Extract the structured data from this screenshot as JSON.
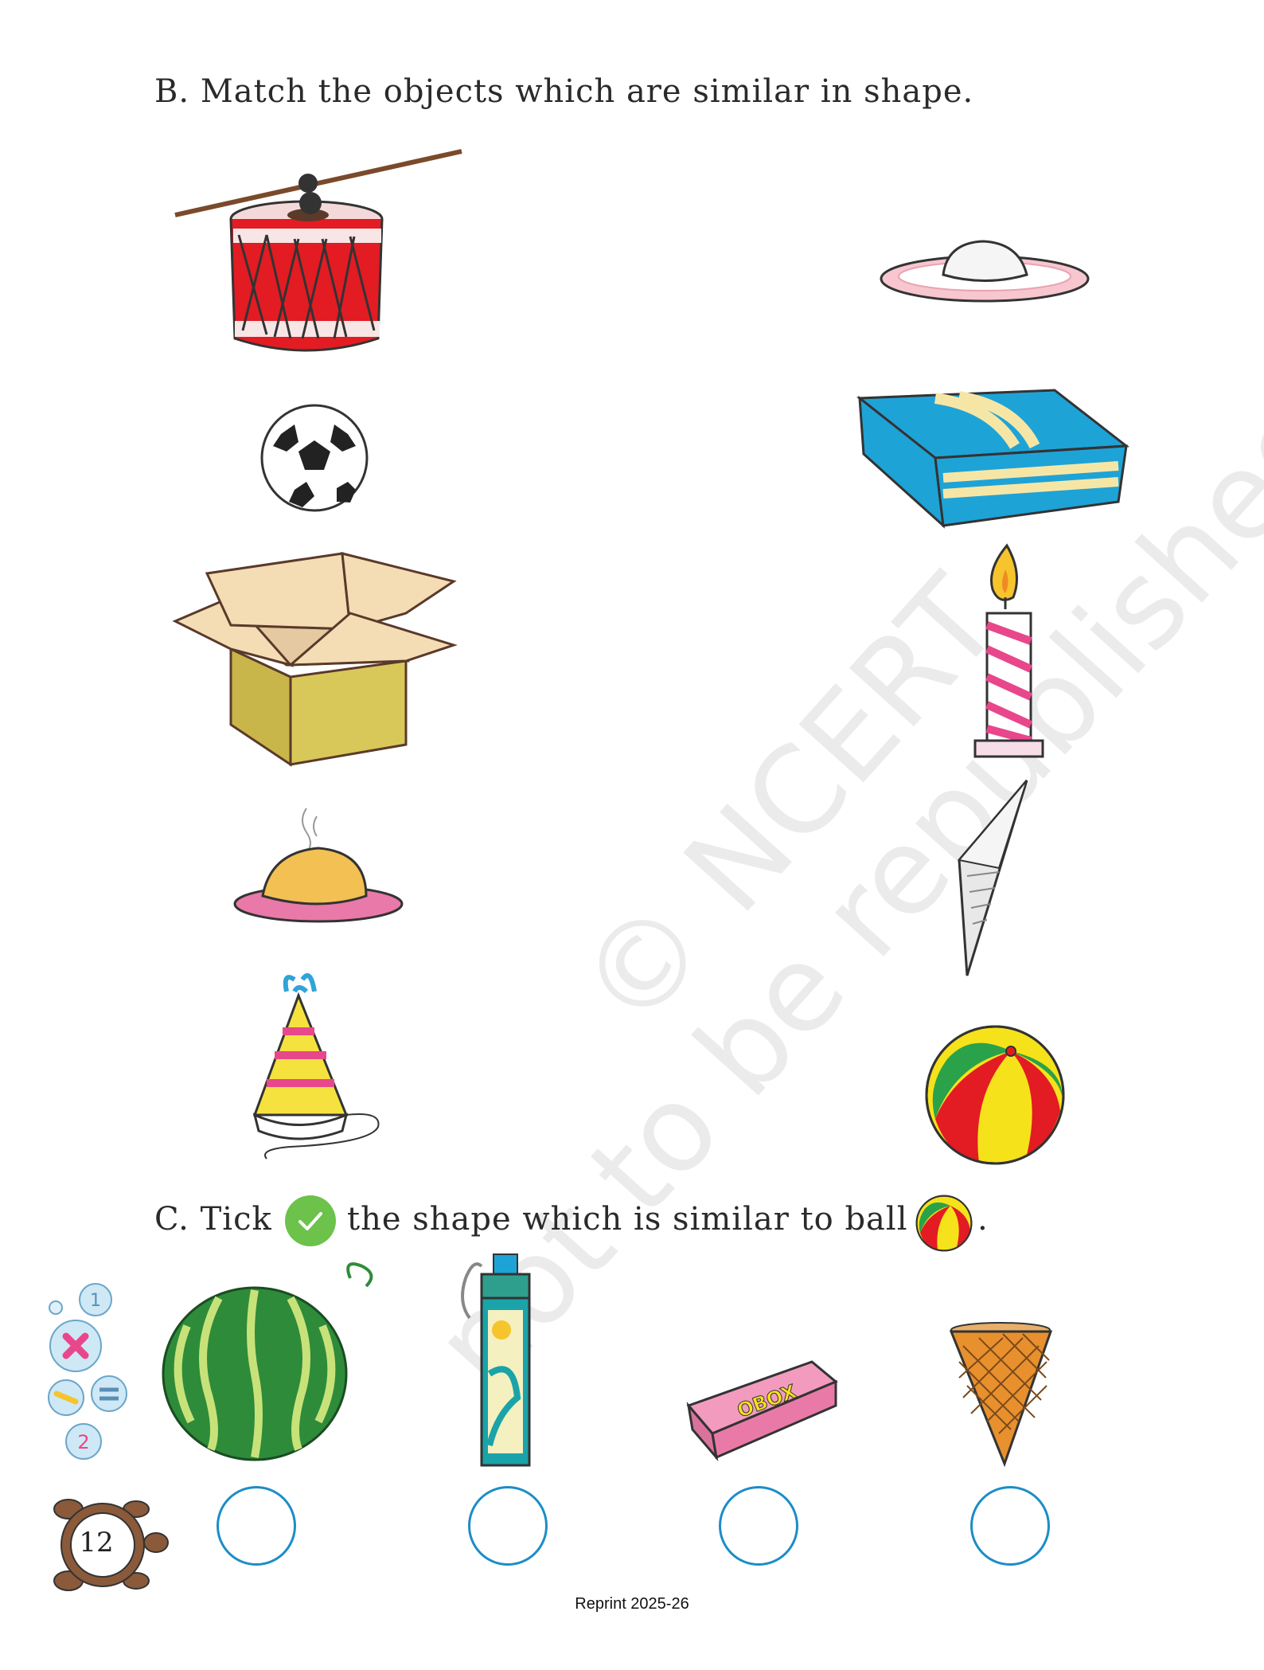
{
  "section_b": {
    "heading": "B. Match the objects which are similar in shape.",
    "left_items": [
      "drum-icon",
      "football-icon",
      "open-box-icon",
      "puri-on-plate-icon",
      "party-hat-icon"
    ],
    "right_items": [
      "cake-on-plate-icon",
      "gift-box-icon",
      "candle-icon",
      "paper-cone-icon",
      "beach-ball-icon"
    ]
  },
  "section_c": {
    "heading_part1": "C. Tick",
    "heading_part2": "the shape which is similar to ball",
    "heading_end": ".",
    "options": [
      "watermelon-icon",
      "water-bottle-icon",
      "pencil-box-icon",
      "ice-cream-cone-icon"
    ]
  },
  "watermark": {
    "line1": "© NCERT",
    "line2": "not to be republished"
  },
  "page_number": "12",
  "footer": "Reprint 2025-26",
  "colors": {
    "circle_border": "#1c8dc7",
    "tick_green": "#6cc24a"
  }
}
